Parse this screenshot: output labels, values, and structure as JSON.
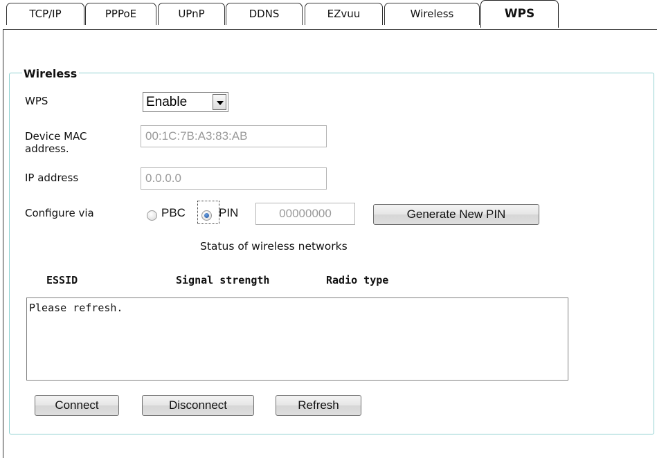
{
  "tabs": [
    {
      "label": "TCP/IP"
    },
    {
      "label": "PPPoE"
    },
    {
      "label": "UPnP"
    },
    {
      "label": "DDNS"
    },
    {
      "label": "EZvuu"
    },
    {
      "label": "Wireless"
    },
    {
      "label": "WPS"
    }
  ],
  "active_tab": "WPS",
  "section": {
    "legend": "Wireless"
  },
  "wps": {
    "label": "WPS",
    "selected": "Enable"
  },
  "mac": {
    "label_line1": "Device MAC",
    "label_line2": "address.",
    "value": "00:1C:7B:A3:83:AB"
  },
  "ip": {
    "label": "IP address",
    "value": "0.0.0.0"
  },
  "configure": {
    "label": "Configure via",
    "options": [
      {
        "label": "PBC",
        "checked": false
      },
      {
        "label": "PIN",
        "checked": true
      }
    ],
    "pin_value": "00000000",
    "generate_label": "Generate New PIN"
  },
  "networks": {
    "title": "Status of wireless networks",
    "columns": [
      "ESSID",
      "Signal strength",
      "Radio type"
    ],
    "list_text": "Please refresh."
  },
  "buttons": {
    "connect": "Connect",
    "disconnect": "Disconnect",
    "refresh": "Refresh"
  }
}
